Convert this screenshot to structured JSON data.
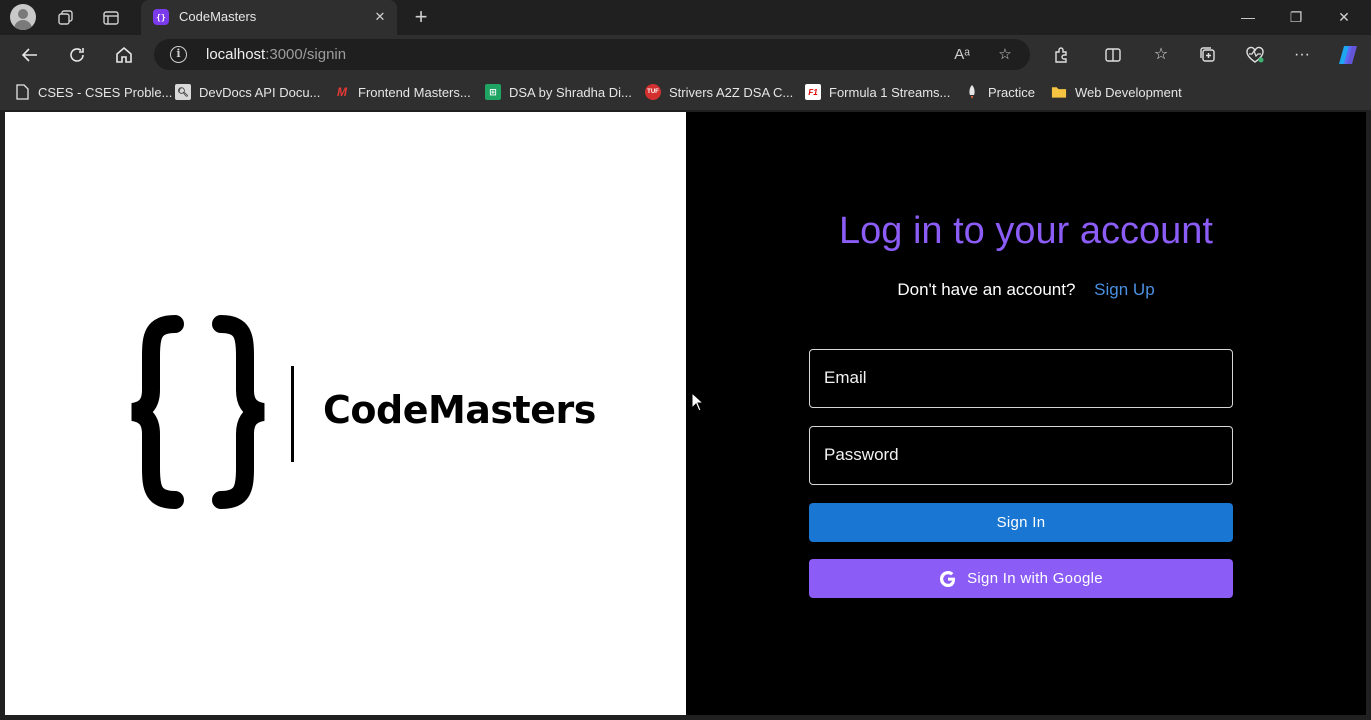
{
  "browser": {
    "tab": {
      "title": "CodeMasters",
      "favicon": "{}"
    },
    "address": {
      "host": "localhost",
      "path": ":3000/signin"
    },
    "bookmarks": [
      {
        "label": "CSES - CSES Proble...",
        "icon": "document-icon"
      },
      {
        "label": "DevDocs API Docu...",
        "icon": "devdocs-icon"
      },
      {
        "label": "Frontend Masters...",
        "icon": "frontend-masters-icon"
      },
      {
        "label": "DSA by Shradha Di...",
        "icon": "sheets-icon"
      },
      {
        "label": "Strivers A2Z DSA C...",
        "icon": "tuf-icon"
      },
      {
        "label": "Formula 1 Streams...",
        "icon": "f1-icon"
      },
      {
        "label": "Practice",
        "icon": "rocket-icon"
      },
      {
        "label": "Web Development",
        "icon": "folder-icon"
      }
    ]
  },
  "logo": {
    "name": "CodeMasters"
  },
  "auth": {
    "heading": "Log in to your account",
    "no_account": "Don't have an account?",
    "signup_link": "Sign Up",
    "email_label": "Email",
    "password_label": "Password",
    "signin_button": "Sign In",
    "google_button": "Sign In with Google"
  },
  "colors": {
    "accent_purple": "#8b5cf6",
    "signin_blue": "#1976d2",
    "link_blue": "#4a90e2"
  }
}
